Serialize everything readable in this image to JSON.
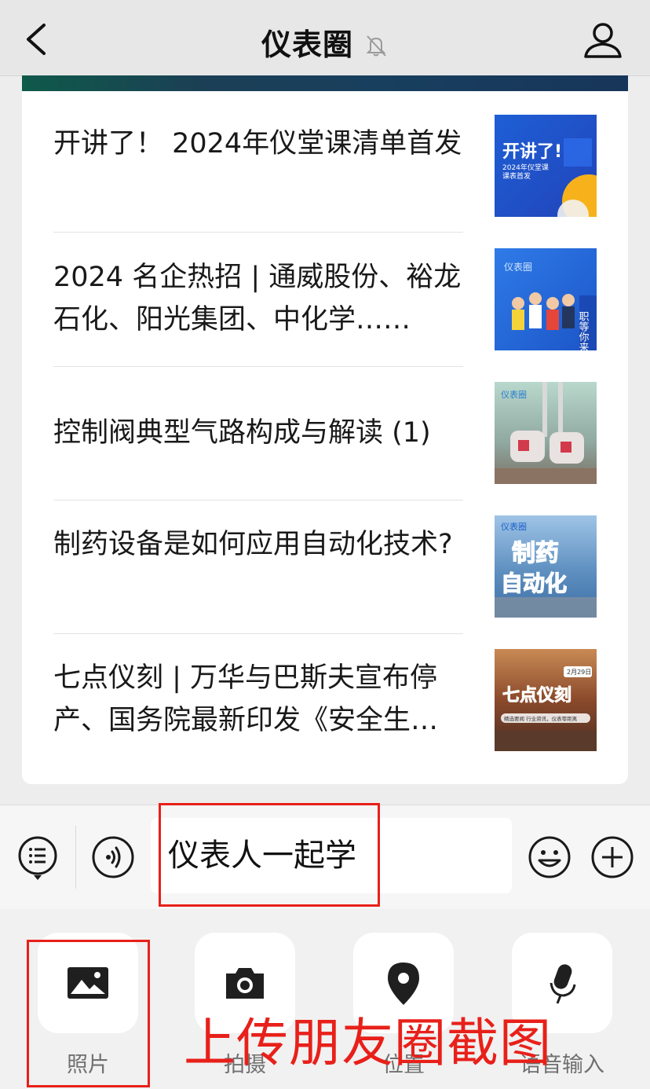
{
  "header": {
    "title": "仪表圈",
    "back_icon": "chevron-left-icon",
    "mute_icon": "bell-off-icon",
    "profile_icon": "person-icon"
  },
  "articles": [
    {
      "title": "开讲了！ 2024年仪堂课清单首发",
      "thumb_text": [
        "开讲了!",
        "2024年仪堂课",
        "课表首发"
      ]
    },
    {
      "title": "2024 名企热招 | 通威股份、裕龙石化、阳光集团、中化学……",
      "thumb_text": [
        "仪表圈",
        "职等你来"
      ]
    },
    {
      "title": "控制阀典型气路构成与解读 (1)",
      "thumb_text": [
        "仪表圈"
      ]
    },
    {
      "title": "制药设备是如何应用自动化技术?",
      "thumb_text": [
        "仪表圈",
        "制药",
        "自动化"
      ]
    },
    {
      "title": "七点仪刻 | 万华与巴斯夫宣布停产、国务院最新印发《安全生…",
      "thumb_text": [
        "2月29日",
        "七点仪刻",
        "精选要闻 行业资讯，仪表零距离"
      ]
    }
  ],
  "input": {
    "value": "仪表人一起学",
    "menu_icon": "list-menu-icon",
    "voice_icon": "voice-icon",
    "emoji_icon": "emoji-icon",
    "plus_icon": "plus-icon"
  },
  "tools": [
    {
      "label": "照片",
      "icon": "photo-icon"
    },
    {
      "label": "拍摄",
      "icon": "camera-icon"
    },
    {
      "label": "位置",
      "icon": "location-pin-icon"
    },
    {
      "label": "语音输入",
      "icon": "microphone-icon"
    }
  ],
  "annotation": {
    "caption": "上传朋友圈截图",
    "color": "#e8201a"
  }
}
